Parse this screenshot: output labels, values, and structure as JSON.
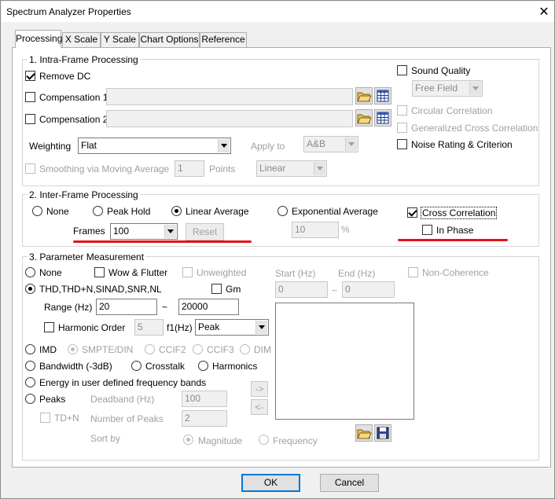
{
  "window": {
    "title": "Spectrum Analyzer Properties",
    "close_glyph": "✕"
  },
  "tabs": [
    "Processing",
    "X Scale",
    "Y Scale",
    "Chart Options",
    "Reference"
  ],
  "intra": {
    "title": "1. Intra-Frame Processing",
    "remove_dc": "Remove DC",
    "comp1": "Compensation 1",
    "comp2": "Compensation 2",
    "weighting_label": "Weighting",
    "weighting_value": "Flat",
    "apply_to_label": "Apply to",
    "apply_to_value": "A&B",
    "smoothing_label": "Smoothing via Moving Average",
    "smoothing_value": "1",
    "points_label": "Points",
    "smoothing_type": "Linear",
    "sound_quality": "Sound Quality",
    "sound_field": "Free Field",
    "circular_corr": "Circular Correlation",
    "gen_cross_corr": "Generalized Cross Correlation",
    "noise_rating": "Noise Rating & Criterion"
  },
  "inter": {
    "title": "2. Inter-Frame Processing",
    "none": "None",
    "peak_hold": "Peak Hold",
    "linear_avg": "Linear Average",
    "exp_avg": "Exponential Average",
    "frames_label": "Frames",
    "frames_value": "100",
    "reset": "Reset",
    "exp_value": "10",
    "percent": "%",
    "cross_corr": "Cross Correlation",
    "in_phase": "In Phase"
  },
  "param": {
    "title": "3. Parameter Measurement",
    "none": "None",
    "wow_flutter": "Wow & Flutter",
    "unweighted": "Unweighted",
    "thd": "THD,THD+N,SINAD,SNR,NL",
    "gm": "Gm",
    "range_label": "Range (Hz)",
    "range_from": "20",
    "tilde": "~",
    "range_to": "20000",
    "harmonic_order": "Harmonic Order",
    "harmonic_value": "5",
    "f1_label": "f1(Hz)",
    "f1_value": "Peak",
    "imd": "IMD",
    "smpte": "SMPTE/DIN",
    "ccif2": "CCIF2",
    "ccif3": "CCIF3",
    "dim": "DIM",
    "bandwidth": "Bandwidth (-3dB)",
    "crosstalk": "Crosstalk",
    "harmonics": "Harmonics",
    "energy": "Energy in user defined frequency bands",
    "peaks": "Peaks",
    "deadband_label": "Deadband (Hz)",
    "deadband_value": "100",
    "td_n": "TD+N",
    "num_peaks_label": "Number of Peaks",
    "num_peaks_value": "2",
    "sort_by": "Sort by",
    "magnitude": "Magnitude",
    "frequency": "Frequency",
    "start_label": "Start (Hz)",
    "end_label": "End (Hz)",
    "start_value": "0",
    "end_value": "0",
    "non_coherence": "Non-Coherence",
    "add_arrow": "->",
    "remove_arrow": "<-"
  },
  "footer": {
    "ok": "OK",
    "cancel": "Cancel"
  },
  "colors": {
    "annotation_red": "#e0141a",
    "accent": "#0078d7"
  },
  "icons": [
    "close-icon",
    "folder-open-icon",
    "table-icon",
    "save-icon",
    "chevron-down-icon"
  ]
}
